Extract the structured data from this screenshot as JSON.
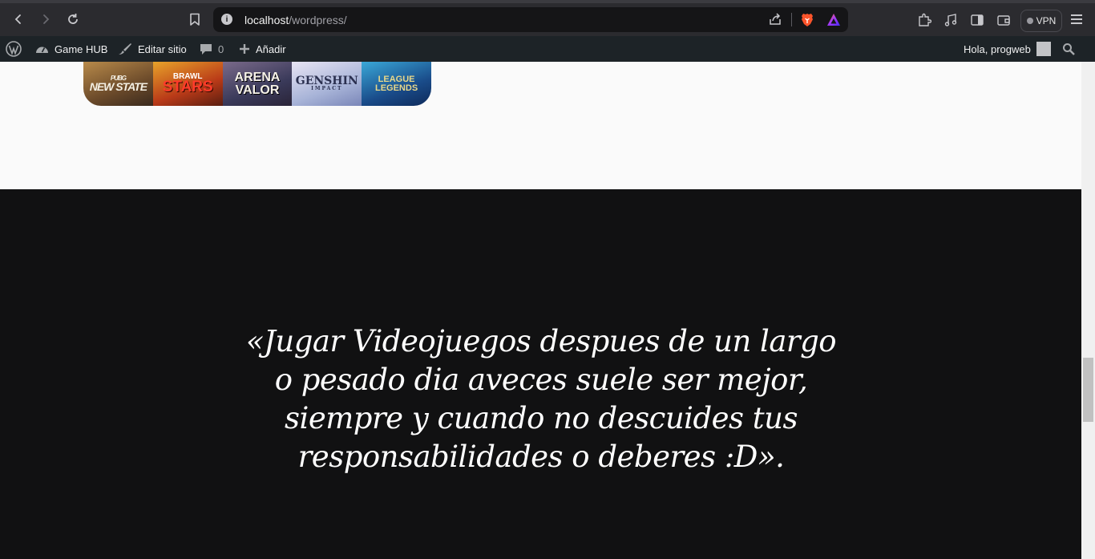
{
  "browser": {
    "url_host": "localhost",
    "url_path": "/wordpress/",
    "vpn_label": "VPN"
  },
  "adminbar": {
    "site_name": "Game HUB",
    "edit_site": "Editar sitio",
    "comments_count": "0",
    "add_new": "Añadir",
    "greeting": "Hola, progweb"
  },
  "banner": {
    "games": [
      {
        "line1": "PUBG",
        "line2": "NEW STATE"
      },
      {
        "line1": "BRAWL",
        "line2": "STARS"
      },
      {
        "line1": "ARENA",
        "line2": "VALOR"
      },
      {
        "line1": "GENSHIN",
        "line2": "IMPACT"
      },
      {
        "line1": "LEAGUE",
        "line2": "LEGENDS"
      }
    ]
  },
  "quote": {
    "text": "«Jugar Videojuegos despues de un largo o pesado dia aveces suele ser mejor, siempre y cuando no descuides tus responsabilidades o deberes :D»."
  },
  "colors": {
    "dark_bg": "#111112",
    "light_bg": "#fafafa",
    "adminbar_bg": "#1d2327",
    "chrome_bg": "#2b2b2f"
  }
}
